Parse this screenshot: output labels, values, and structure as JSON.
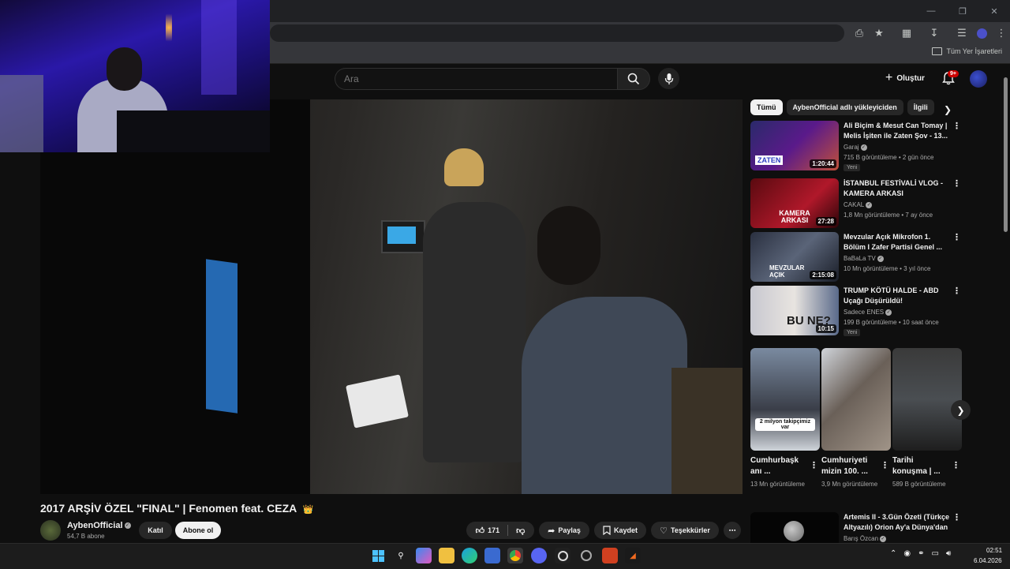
{
  "browser": {
    "bookmarks_all_label": "Tüm Yer İşaretleri"
  },
  "header": {
    "search_placeholder": "Ara",
    "create_label": "Oluştur",
    "notifications_badge": "9+"
  },
  "video": {
    "title": "2017 ARŞİV ÖZEL \"FINAL\" | Fenomen feat. CEZA",
    "title_emoji": "👑",
    "channel_name": "AybenOfficial",
    "subscribers": "54,7 B abone",
    "join_label": "Katıl",
    "subscribe_label": "Abone ol",
    "like_count": "171",
    "share_label": "Paylaş",
    "save_label": "Kaydet",
    "thanks_label": "Teşekkürler"
  },
  "sidebar": {
    "chips": [
      "Tümü",
      "AybenOfficial adlı yükleyiciden",
      "İlgili"
    ],
    "recommendations": [
      {
        "title": "Ali Biçim & Mesut Can Tomay | Melis İşiten ile Zaten Şov - 13...",
        "channel": "Garaj",
        "meta": "715 B görüntüleme • 2 gün önce",
        "badge": "Yeni",
        "duration": "1:20:44",
        "thumb_text": "ZATEN"
      },
      {
        "title": "İSTANBUL FESTİVALİ VLOG - KAMERA ARKASI",
        "channel": "CAKAL",
        "meta": "1,8 Mn görüntüleme • 7 ay önce",
        "badge": "",
        "duration": "27:28",
        "thumb_text": "KAMERA ARKASI"
      },
      {
        "title": "Mevzular Açık Mikrofon 1. Bölüm I Zafer Partisi Genel ...",
        "channel": "BaBaLa TV",
        "meta": "10 Mn görüntüleme • 3 yıl önce",
        "badge": "",
        "duration": "2:15:08",
        "thumb_text": "MEVZULAR AÇIK"
      },
      {
        "title": "TRUMP KÖTÜ HALDE - ABD Uçağı Düşürüldü!",
        "channel": "Sadece ENES",
        "meta": "199 B görüntüleme • 10 saat önce",
        "badge": "Yeni",
        "duration": "10:15",
        "thumb_text": "BU NE?"
      }
    ],
    "shorts": [
      {
        "title": "Cumhurbaşk anı ...",
        "views": "13 Mn görüntüleme",
        "thumb_text": "2 milyon takipçimiz var"
      },
      {
        "title": "Cumhuriyeti mizin 100. ...",
        "views": "3,9 Mn görüntüleme",
        "thumb_text": ""
      },
      {
        "title": "Tarihi konuşma | ...",
        "views": "589 B görüntüleme",
        "thumb_text": ""
      }
    ],
    "next_recommendation": {
      "title": "Artemis II - 3.Gün Özeti (Türkçe Altyazılı) Orion Ay'a Dünya'dan ...",
      "channel": "Barış Özcan"
    }
  },
  "taskbar": {
    "time": "02:51",
    "date": "6.04.2026"
  },
  "colors": {
    "background": "#0f0f0f",
    "chip_active": "#f1f1f1",
    "badge_red": "#cc0000"
  }
}
